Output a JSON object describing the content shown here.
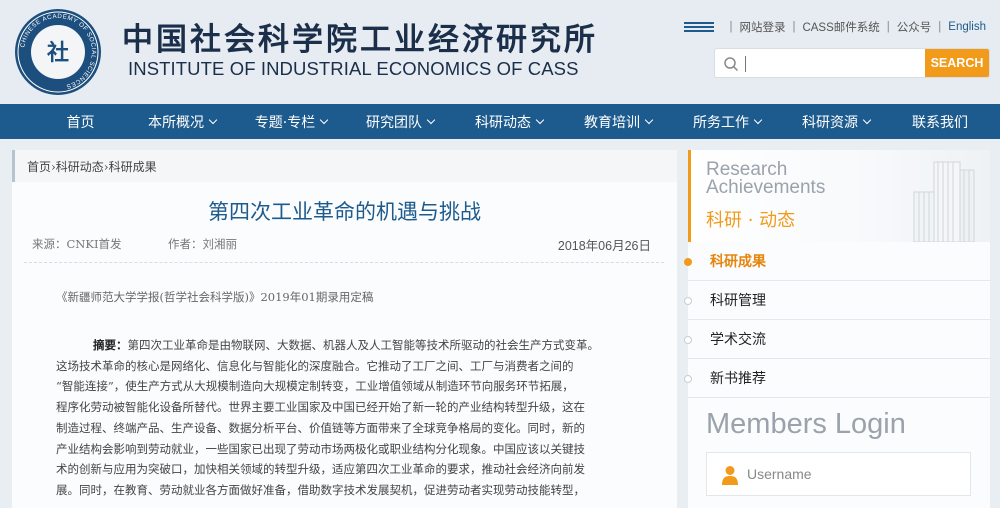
{
  "header": {
    "title_cn": "中国社会科学院工业经济研究所",
    "title_en": "INSTITUTE OF INDUSTRIAL ECONOMICS OF CASS",
    "logo_text": "CHINESE ACADEMY OF SOCIAL SCIENCES",
    "top_links": [
      "网站登录",
      "CASS邮件系统",
      "公众号",
      "English"
    ],
    "search": {
      "placeholder": "",
      "button_label": "SEARCH"
    }
  },
  "nav": {
    "items": [
      {
        "label": "首页",
        "dropdown": false
      },
      {
        "label": "本所概况",
        "dropdown": true
      },
      {
        "label": "专题·专栏",
        "dropdown": true
      },
      {
        "label": "研究团队",
        "dropdown": true
      },
      {
        "label": "科研动态",
        "dropdown": true
      },
      {
        "label": "教育培训",
        "dropdown": true
      },
      {
        "label": "所务工作",
        "dropdown": true
      },
      {
        "label": "科研资源",
        "dropdown": true
      },
      {
        "label": "联系我们",
        "dropdown": false
      }
    ]
  },
  "breadcrumb": "首页›科研动态›科研成果",
  "article": {
    "title": "第四次工业革命的机遇与挑战",
    "source_label": "来源：CNKI首发",
    "author_label": "作者：刘湘丽",
    "date": "2018年06月26日",
    "journal": "《新疆师范大学学报(哲学社会科学版)》2019年01期录用定稿",
    "abstract_label": "摘要：",
    "abstract_lines": [
      "第四次工业革命是由物联网、大数据、机器人及人工智能等技术所驱动的社会生产方式变革。",
      "这场技术革命的核心是网络化、信息化与智能化的深度融合。它推动了工厂之间、工厂与消费者之间的",
      "“智能连接”，使生产方式从大规模制造向大规模定制转变，工业增值领域从制造环节向服务环节拓展，",
      "程序化劳动被智能化设备所替代。世界主要工业国家及中国已经开始了新一轮的产业结构转型升级，这在",
      "制造过程、终端产品、生产设备、数据分析平台、价值链等方面带来了全球竞争格局的变化。同时，新的",
      "产业结构会影响到劳动就业，一些国家已出现了劳动市场两极化或职业结构分化现象。中国应该以关键技",
      "术的创新与应用为突破口，加快相关领域的转型升级，适应第四次工业革命的要求，推动社会经济向前发",
      "展。同时，在教育、劳动就业各方面做好准备，借助数字技术发展契机，促进劳动者实现劳动技能转型，"
    ]
  },
  "sidebar": {
    "banner_en_line1": "Research",
    "banner_en_line2": "Achievements",
    "banner_cn": "科研 · 动态",
    "items": [
      {
        "label": "科研成果",
        "active": true
      },
      {
        "label": "科研管理",
        "active": false
      },
      {
        "label": "学术交流",
        "active": false
      },
      {
        "label": "新书推荐",
        "active": false
      }
    ],
    "login_title": "Members Login",
    "username_placeholder": "Username"
  },
  "colors": {
    "nav_blue": "#1d5b8e",
    "accent_orange": "#f29a19",
    "title_blue": "#1d5b8e"
  },
  "icons": [
    "institute-logo-icon",
    "menu-icon",
    "search-icon",
    "chevron-down-icon",
    "building-icon",
    "user-icon"
  ]
}
